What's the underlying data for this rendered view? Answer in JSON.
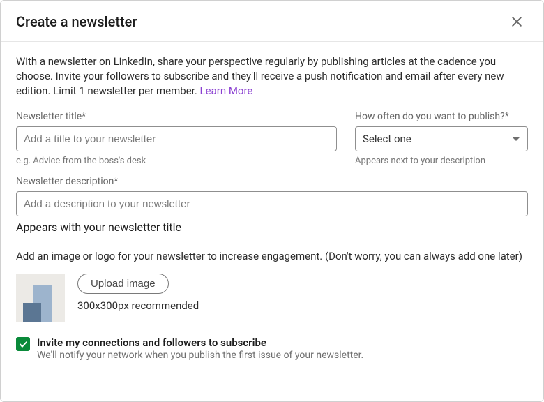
{
  "header": {
    "title": "Create a newsletter"
  },
  "intro": {
    "text": "With a newsletter on LinkedIn, share your perspective regularly by publishing articles at the cadence you choose. Invite your followers to subscribe and they'll receive a push notification and email after every new edition. Limit 1 newsletter per member. ",
    "learn_more": "Learn More"
  },
  "fields": {
    "title": {
      "label": "Newsletter title*",
      "placeholder": "Add a title to your newsletter",
      "hint": "e.g. Advice from the boss's desk"
    },
    "frequency": {
      "label": "How often do you want to publish?*",
      "selected": "Select one",
      "hint": "Appears next to your description"
    },
    "description": {
      "label": "Newsletter description*",
      "placeholder": "Add a description to your newsletter",
      "appears": "Appears with your newsletter title"
    }
  },
  "image": {
    "prompt": "Add an image or logo for your newsletter to increase engagement. (Don't worry, you can always add one later)",
    "upload_label": "Upload image",
    "recommended": "300x300px recommended"
  },
  "invite": {
    "title": "Invite my connections and followers to subscribe",
    "sub": "We'll notify your network when you publish the first issue of your newsletter."
  }
}
